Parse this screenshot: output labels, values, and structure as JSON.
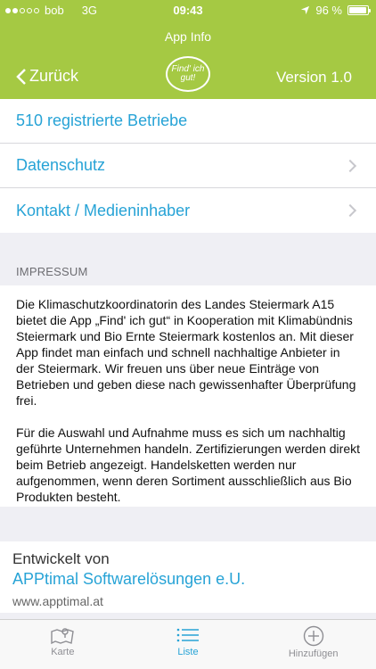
{
  "status_bar": {
    "carrier": "bob",
    "network": "3G",
    "time": "09:43",
    "battery": "96 %",
    "battery_level": 0.96
  },
  "nav": {
    "title": "App Info",
    "back_label": "Zurück",
    "logo_text": "Find' ich gut!",
    "version": "Version 1.0"
  },
  "list": {
    "registered": "510 registrierte Betriebe",
    "privacy": "Datenschutz",
    "contact": "Kontakt / Medieninhaber"
  },
  "impressum": {
    "header": "IMPRESSUM",
    "paragraph1": "Die Klimaschutzkoordinatorin des Landes Steiermark A15 bietet die App „Find' ich gut“ in Kooperation mit Klimabündnis Steiermark und Bio Ernte Steiermark kostenlos an. Mit dieser App findet man einfach und schnell nachhaltige Anbieter in der Steiermark. Wir freuen uns über neue Einträge von Betrieben und geben diese nach gewissenhafter Überprüfung frei.",
    "paragraph2": "Für die Auswahl und Aufnahme muss es sich um nachhaltig geführte Unternehmen handeln. Zertifizierungen werden direkt beim Betrieb angezeigt. Handelsketten werden nur aufgenommen, wenn deren Sortiment ausschließlich aus Bio Produkten besteht."
  },
  "developer": {
    "label": "Entwickelt von",
    "company": "APPtimal Softwarelösungen e.U.",
    "url": "www.apptimal.at"
  },
  "tabs": [
    {
      "label": "Karte",
      "icon": "map-icon"
    },
    {
      "label": "Liste",
      "icon": "list-icon"
    },
    {
      "label": "Hinzufügen",
      "icon": "plus-circle-icon"
    }
  ],
  "colors": {
    "header": "#a5c943",
    "accent": "#27a3d6"
  }
}
